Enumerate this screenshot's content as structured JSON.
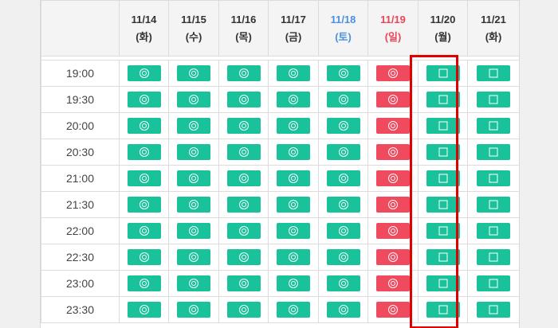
{
  "columns": [
    {
      "date": "11/14",
      "dow": "(화)",
      "type": "weekday"
    },
    {
      "date": "11/15",
      "dow": "(수)",
      "type": "weekday"
    },
    {
      "date": "11/16",
      "dow": "(목)",
      "type": "weekday"
    },
    {
      "date": "11/17",
      "dow": "(금)",
      "type": "weekday"
    },
    {
      "date": "11/18",
      "dow": "(토)",
      "type": "sat"
    },
    {
      "date": "11/19",
      "dow": "(일)",
      "type": "sun"
    },
    {
      "date": "11/20",
      "dow": "(월)",
      "type": "weekday"
    },
    {
      "date": "11/21",
      "dow": "(화)",
      "type": "weekday"
    }
  ],
  "rows": [
    {
      "time": "19:00",
      "slots": [
        "circle",
        "circle",
        "circle",
        "circle",
        "circle",
        "circle-red",
        "square",
        "square"
      ]
    },
    {
      "time": "19:30",
      "slots": [
        "circle",
        "circle",
        "circle",
        "circle",
        "circle",
        "circle-red",
        "square",
        "square"
      ]
    },
    {
      "time": "20:00",
      "slots": [
        "circle",
        "circle",
        "circle",
        "circle",
        "circle",
        "circle-red",
        "square",
        "square"
      ]
    },
    {
      "time": "20:30",
      "slots": [
        "circle",
        "circle",
        "circle",
        "circle",
        "circle",
        "circle-red",
        "square",
        "square"
      ]
    },
    {
      "time": "21:00",
      "slots": [
        "circle",
        "circle",
        "circle",
        "circle",
        "circle",
        "circle-red",
        "square",
        "square"
      ]
    },
    {
      "time": "21:30",
      "slots": [
        "circle",
        "circle",
        "circle",
        "circle",
        "circle",
        "circle-red",
        "square",
        "square"
      ]
    },
    {
      "time": "22:00",
      "slots": [
        "circle",
        "circle",
        "circle",
        "circle",
        "circle",
        "circle-red",
        "square",
        "square"
      ]
    },
    {
      "time": "22:30",
      "slots": [
        "circle",
        "circle",
        "circle",
        "circle",
        "circle",
        "circle-red",
        "square",
        "square"
      ]
    },
    {
      "time": "23:00",
      "slots": [
        "circle",
        "circle",
        "circle",
        "circle",
        "circle",
        "circle-red",
        "square",
        "square"
      ]
    },
    {
      "time": "23:30",
      "slots": [
        "circle",
        "circle",
        "circle",
        "circle",
        "circle",
        "circle-red",
        "square",
        "square"
      ]
    }
  ],
  "colors": {
    "available": "#19c29a",
    "sunday_slot": "#ef4a5e",
    "saturday_text": "#4a90e2",
    "sunday_text": "#e8465a",
    "highlight_border": "#e00000"
  },
  "icons": {
    "circle": "double-circle-icon",
    "square": "square-icon"
  },
  "highlighted_column": "11/19"
}
